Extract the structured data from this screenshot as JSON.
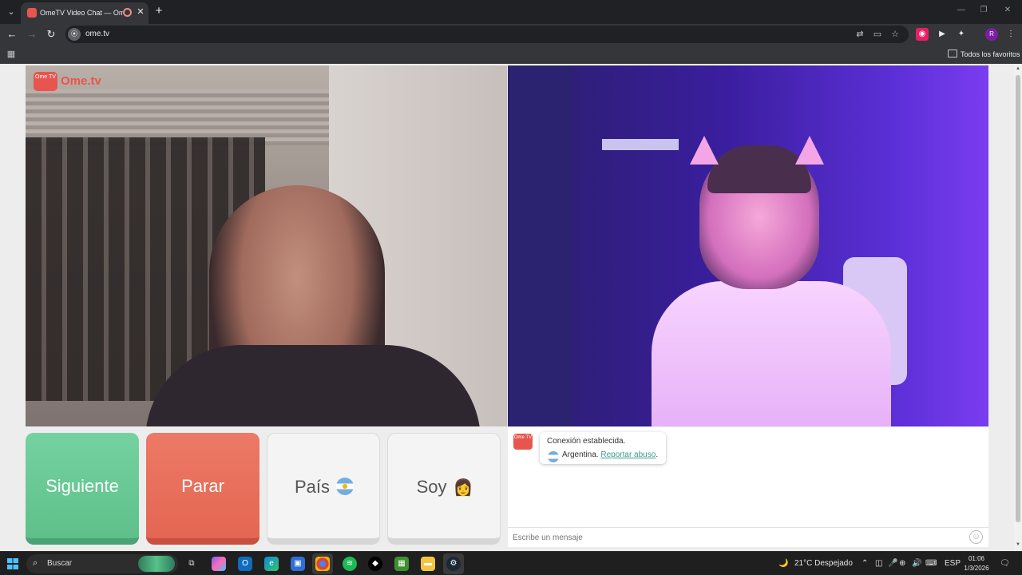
{
  "browser": {
    "tab_title": "OmeTV Video Chat — Ome",
    "url": "ome.tv",
    "bookmarks_folder": "Todos los favoritos",
    "profile_initial": "R"
  },
  "page": {
    "logo_box": "Ome TV",
    "logo_text": "Ome.tv",
    "buttons": {
      "next": "Siguiente",
      "stop": "Parar",
      "country": "País",
      "me": "Soy"
    },
    "chat": {
      "logo": "Ome TV",
      "status": "Conexión establecida.",
      "country": "Argentina.",
      "report_link": "Reportar abuso",
      "report_suffix": ".",
      "input_placeholder": "Escribe un mensaje"
    },
    "colors": {
      "next": "#5fc08a",
      "stop": "#e46653",
      "brand": "#e8554e",
      "link": "#3a9c8f"
    }
  },
  "taskbar": {
    "search_placeholder": "Buscar",
    "weather": "21°C  Despejado",
    "language": "ESP",
    "time": "01:06",
    "date": "1/3/2026"
  }
}
